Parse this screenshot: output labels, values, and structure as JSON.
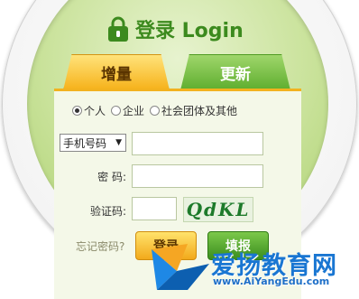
{
  "header": {
    "title": "登录 Login"
  },
  "tabs": [
    {
      "label": "增量",
      "active": true
    },
    {
      "label": "更新",
      "active": false
    }
  ],
  "account_type": {
    "options": [
      "个人",
      "企业",
      "社会团体及其他"
    ],
    "selected": "个人"
  },
  "form": {
    "id_type": {
      "value": "手机号码"
    },
    "id_value": {
      "value": ""
    },
    "password": {
      "label": "密 码:",
      "value": ""
    },
    "captcha": {
      "label": "验证码:",
      "value": "",
      "image_text": "QdKL"
    }
  },
  "links": {
    "forgot_password": "忘记密码?"
  },
  "buttons": {
    "login": "登录",
    "fill": "填报"
  },
  "watermark": {
    "text": "爱扬教育网",
    "url": "www.AiYangEdu.com"
  },
  "colors": {
    "accent_orange": "#f6b21b",
    "accent_green": "#5fae2f",
    "panel_bg": "#c9e29a"
  }
}
